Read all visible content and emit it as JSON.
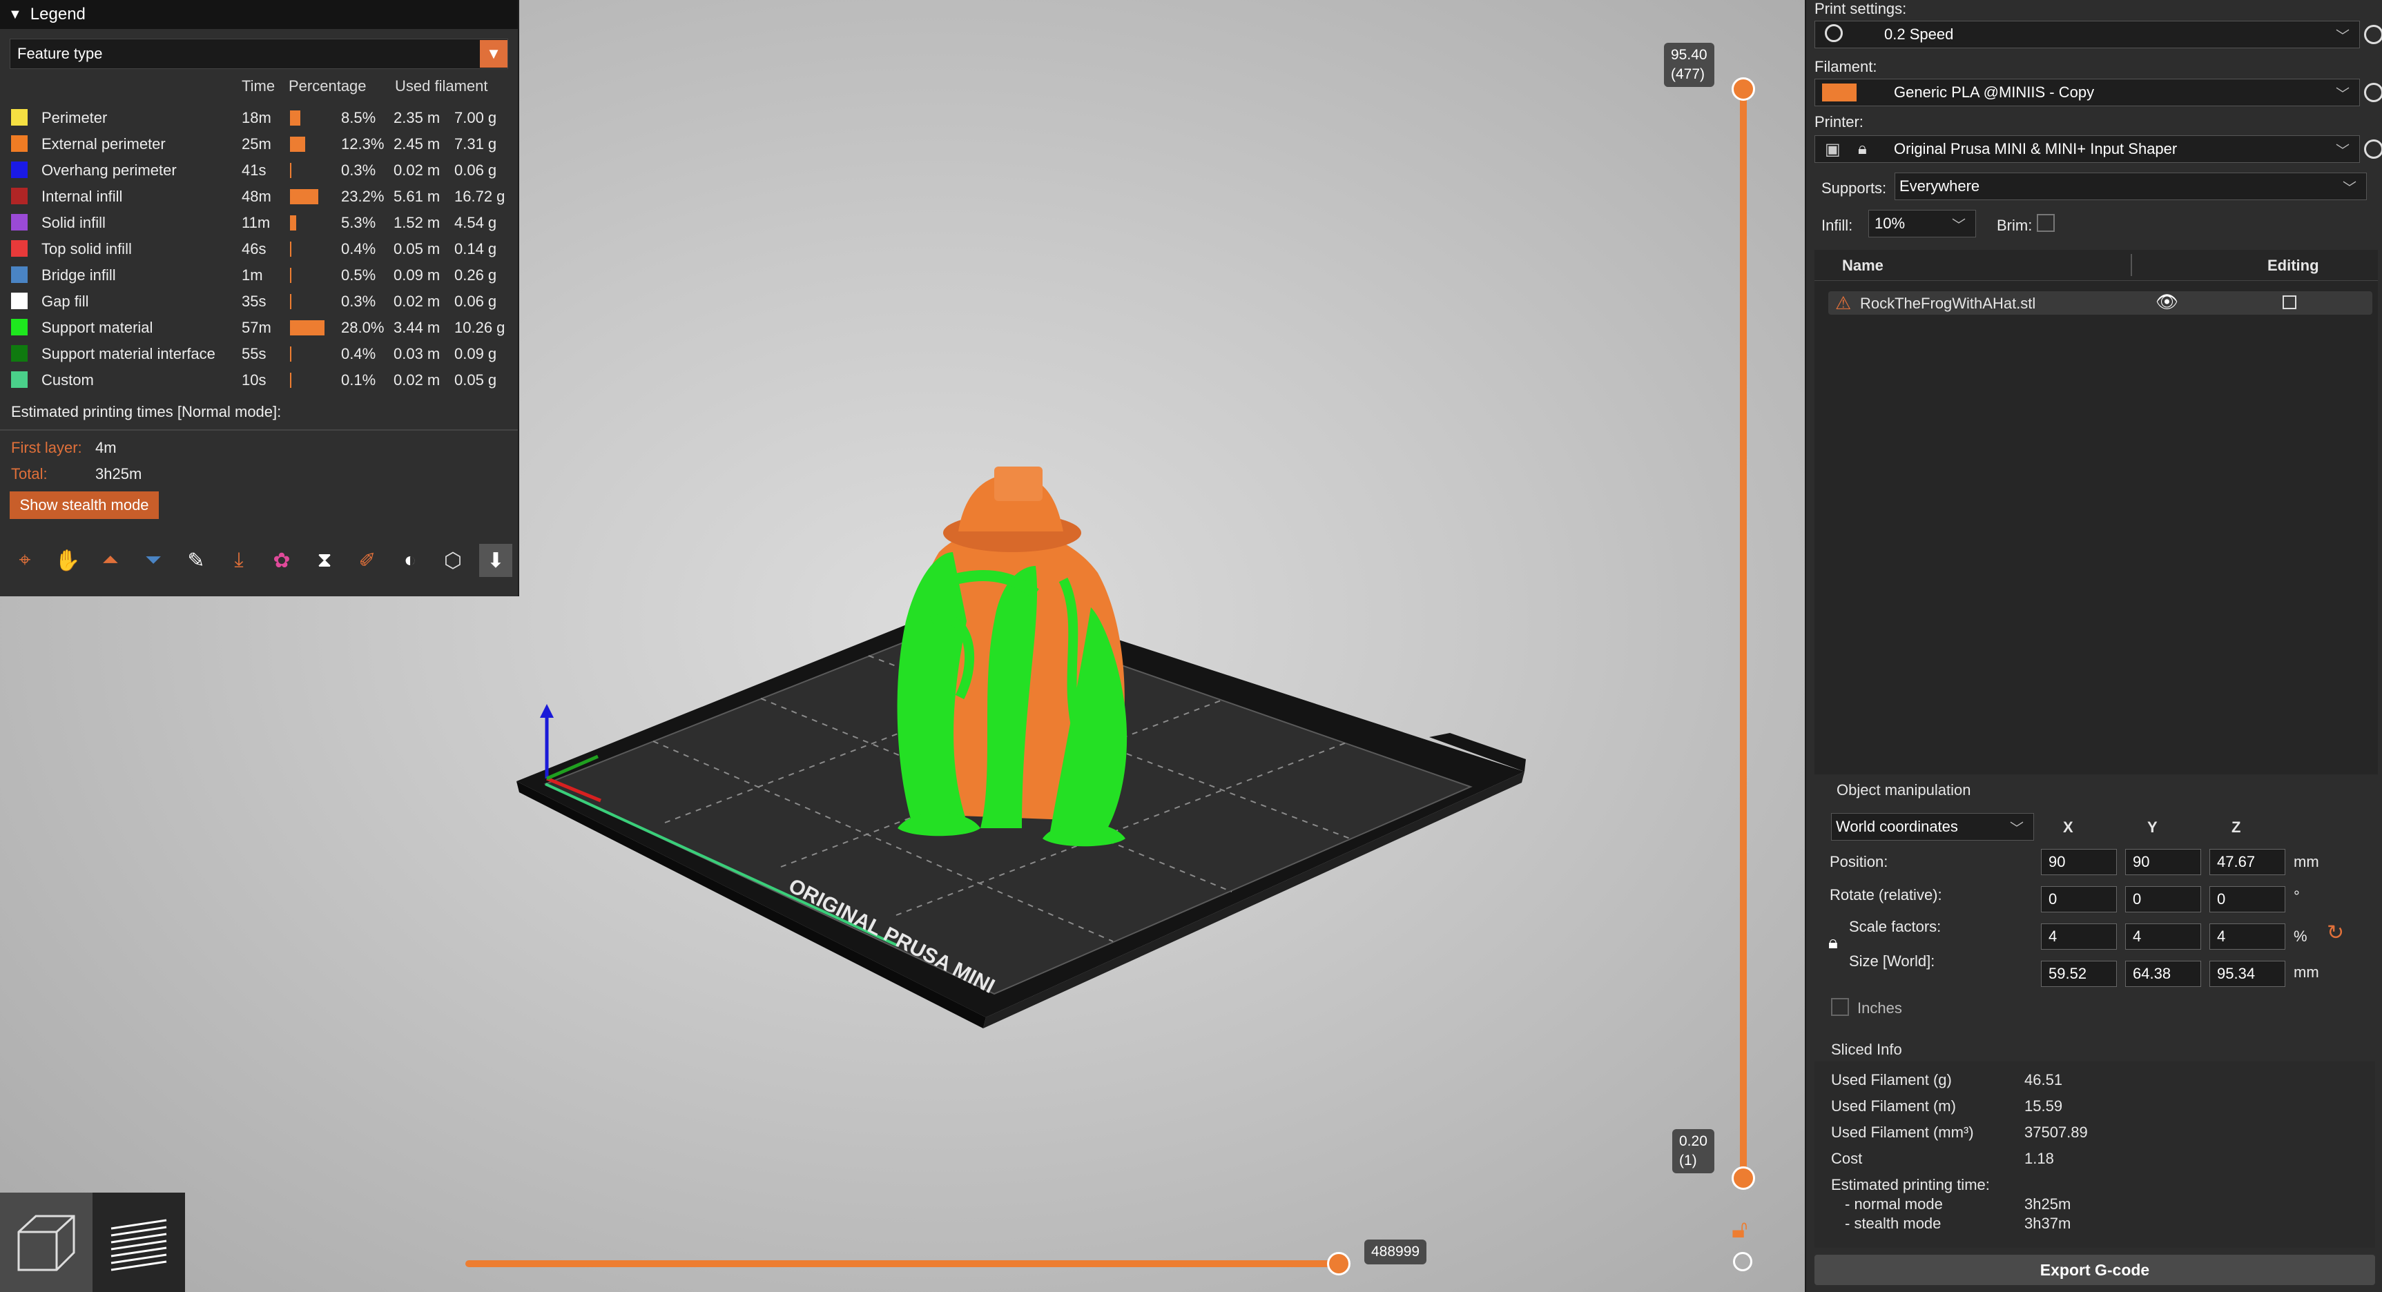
{
  "legend": {
    "title": "Legend",
    "view_type": "Feature type",
    "columns": {
      "time": "Time",
      "percentage": "Percentage",
      "used_filament": "Used filament"
    },
    "items": [
      {
        "label": "Perimeter",
        "color": "#f5e042",
        "time": "18m",
        "pct_value": 8.5,
        "pct": "8.5%",
        "len": "2.35 m",
        "weight": "7.00 g"
      },
      {
        "label": "External perimeter",
        "color": "#f07c24",
        "time": "25m",
        "pct_value": 12.3,
        "pct": "12.3%",
        "len": "2.45 m",
        "weight": "7.31 g"
      },
      {
        "label": "Overhang perimeter",
        "color": "#1a1ae6",
        "time": "41s",
        "pct_value": 0.3,
        "pct": "0.3%",
        "len": "0.02 m",
        "weight": "0.06 g"
      },
      {
        "label": "Internal infill",
        "color": "#b02525",
        "time": "48m",
        "pct_value": 23.2,
        "pct": "23.2%",
        "len": "5.61 m",
        "weight": "16.72 g"
      },
      {
        "label": "Solid infill",
        "color": "#9a4ad6",
        "time": "11m",
        "pct_value": 5.3,
        "pct": "5.3%",
        "len": "1.52 m",
        "weight": "4.54 g"
      },
      {
        "label": "Top solid infill",
        "color": "#e83a3a",
        "time": "46s",
        "pct_value": 0.4,
        "pct": "0.4%",
        "len": "0.05 m",
        "weight": "0.14 g"
      },
      {
        "label": "Bridge infill",
        "color": "#4a84c4",
        "time": "1m",
        "pct_value": 0.5,
        "pct": "0.5%",
        "len": "0.09 m",
        "weight": "0.26 g"
      },
      {
        "label": "Gap fill",
        "color": "#ffffff",
        "time": "35s",
        "pct_value": 0.3,
        "pct": "0.3%",
        "len": "0.02 m",
        "weight": "0.06 g"
      },
      {
        "label": "Support material",
        "color": "#1ee81e",
        "time": "57m",
        "pct_value": 28.0,
        "pct": "28.0%",
        "len": "3.44 m",
        "weight": "10.26 g"
      },
      {
        "label": "Support material interface",
        "color": "#0f7a0f",
        "time": "55s",
        "pct_value": 0.4,
        "pct": "0.4%",
        "len": "0.03 m",
        "weight": "0.09 g"
      },
      {
        "label": "Custom",
        "color": "#4ad08a",
        "time": "10s",
        "pct_value": 0.1,
        "pct": "0.1%",
        "len": "0.02 m",
        "weight": "0.05 g"
      }
    ],
    "estimated_title": "Estimated printing times [Normal mode]:",
    "first_layer_label": "First layer:",
    "first_layer_value": "4m",
    "total_label": "Total:",
    "total_value": "3h25m",
    "stealth_button": "Show stealth mode",
    "toolbar_icons": [
      "travel-icon",
      "wipe-icon",
      "retractions-icon",
      "deretractions-icon",
      "seams-icon",
      "tool-changes-icon",
      "color-changes-icon",
      "pause-prints-icon",
      "custom-gcodes-icon",
      "center-of-gravity-icon",
      "shells-icon",
      "tool-marker-icon"
    ]
  },
  "layer_slider": {
    "top_height": "95.40",
    "top_layer": "(477)",
    "bottom_height": "0.20",
    "bottom_layer": "(1)"
  },
  "move_slider": {
    "value": "488999"
  },
  "bed_text": "ORIGINAL PRUSA MINI",
  "sidebar": {
    "print_settings_label": "Print settings:",
    "print_settings_value": "0.2 Speed",
    "filament_label": "Filament:",
    "filament_value": "Generic PLA @MINIIS - Copy",
    "filament_color": "#ed7d31",
    "printer_label": "Printer:",
    "printer_value": "Original Prusa MINI & MINI+ Input Shaper",
    "supports_label": "Supports:",
    "supports_value": "Everywhere",
    "infill_label": "Infill:",
    "infill_value": "10%",
    "brim_label": "Brim:",
    "list_name_header": "Name",
    "list_editing_header": "Editing",
    "object_name": "RockTheFrogWithAHat.stl",
    "object_manipulation_title": "Object manipulation",
    "coord_system": "World coordinates",
    "axes": [
      "X",
      "Y",
      "Z"
    ],
    "position_label": "Position:",
    "position": [
      "90",
      "90",
      "47.67"
    ],
    "position_unit": "mm",
    "rotate_label": "Rotate (relative):",
    "rotate": [
      "0",
      "0",
      "0"
    ],
    "rotate_unit": "°",
    "scale_label": "Scale factors:",
    "scale": [
      "4",
      "4",
      "4"
    ],
    "scale_unit": "%",
    "size_label": "Size [World]:",
    "size": [
      "59.52",
      "64.38",
      "95.34"
    ],
    "size_unit": "mm",
    "inches_label": "Inches",
    "sliced_info_title": "Sliced Info",
    "sliced_info": [
      {
        "label": "Used Filament (g)",
        "value": "46.51"
      },
      {
        "label": "Used Filament (m)",
        "value": "15.59"
      },
      {
        "label": "Used Filament (mm³)",
        "value": "37507.89"
      },
      {
        "label": "Cost",
        "value": "1.18"
      }
    ],
    "est_time_label": "Estimated printing time:",
    "normal_mode_label": "- normal mode",
    "normal_mode_value": "3h25m",
    "stealth_mode_label": "- stealth mode",
    "stealth_mode_value": "3h37m",
    "export_button": "Export G-code"
  }
}
